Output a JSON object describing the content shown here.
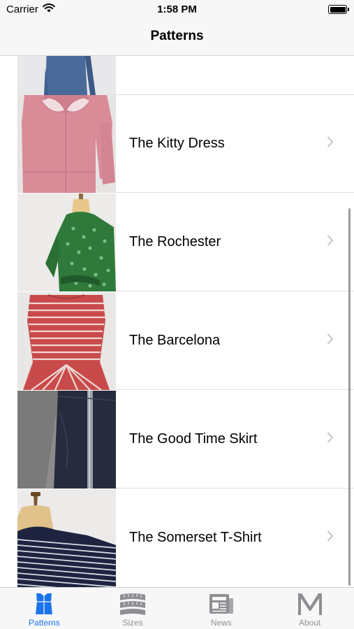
{
  "status_bar": {
    "carrier": "Carrier",
    "time": "1:58 PM"
  },
  "nav": {
    "title": "Patterns"
  },
  "patterns": [
    {
      "name": "",
      "image": "blue-dress-photo"
    },
    {
      "name": "The Kitty Dress",
      "image": "pink-dress-photo"
    },
    {
      "name": "The Rochester",
      "image": "green-blouse-photo"
    },
    {
      "name": "The Barcelona",
      "image": "red-striped-top-photo"
    },
    {
      "name": "The Good Time Skirt",
      "image": "denim-skirt-photo"
    },
    {
      "name": "The Somerset T-Shirt",
      "image": "striped-tshirt-photo"
    }
  ],
  "tabs": [
    {
      "label": "Patterns",
      "icon": "dress-form-icon",
      "active": true
    },
    {
      "label": "Sizes",
      "icon": "measuring-tape-icon",
      "active": false
    },
    {
      "label": "News",
      "icon": "newspaper-icon",
      "active": false
    },
    {
      "label": "About",
      "icon": "m-logo-icon",
      "active": false
    }
  ],
  "colors": {
    "tint": "#1a73e8",
    "inactive": "#929292"
  }
}
